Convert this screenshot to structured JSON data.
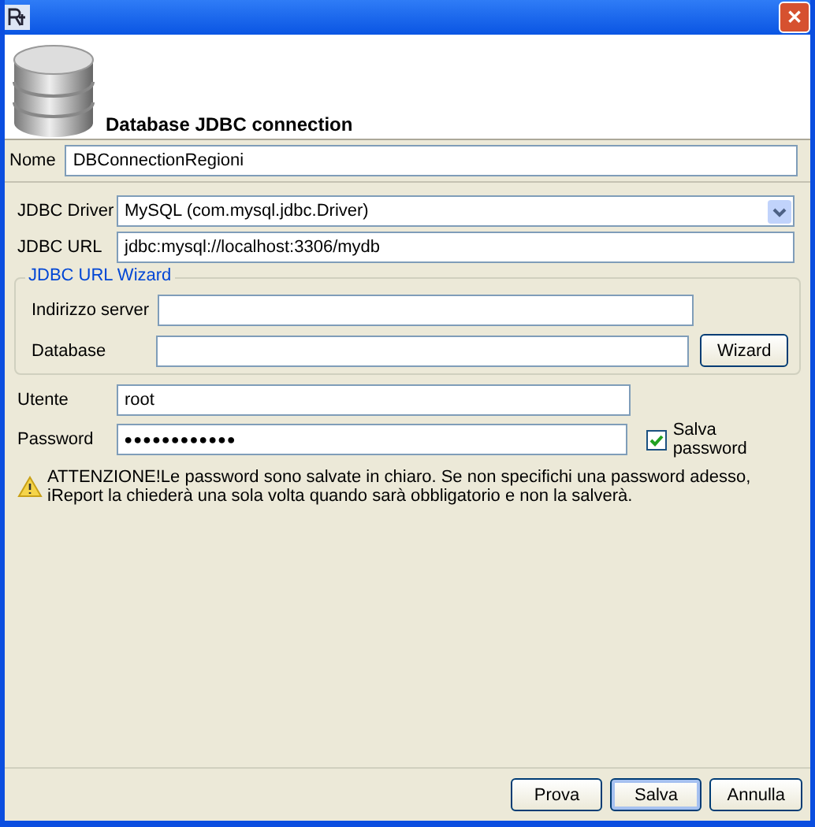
{
  "window": {
    "close": "✕"
  },
  "header": {
    "title": "Database JDBC connection"
  },
  "name_field": {
    "label": "Nome",
    "value": "DBConnectionRegioni"
  },
  "driver": {
    "label": "JDBC Driver",
    "value": "MySQL (com.mysql.jdbc.Driver)"
  },
  "url": {
    "label": "JDBC URL",
    "value": "jdbc:mysql://localhost:3306/mydb"
  },
  "wizard_group": {
    "title": "JDBC URL Wizard",
    "server_label": "Indirizzo server",
    "database_label": "Database",
    "button": "Wizard"
  },
  "user": {
    "label": "Utente",
    "value": "root"
  },
  "password": {
    "label": "Password",
    "value": "●●●●●●●●●●●●",
    "save_label": "Salva password",
    "save_checked": true
  },
  "warning": "ATTENZIONE!Le password sono salvate in chiaro. Se non specifichi una password adesso, iReport la chiederà una sola volta quando sarà obbligatorio e non la salverà.",
  "buttons": [
    {
      "label": "Prova",
      "focused": false
    },
    {
      "label": "Salva",
      "focused": true
    },
    {
      "label": "Annulla",
      "focused": false
    }
  ]
}
